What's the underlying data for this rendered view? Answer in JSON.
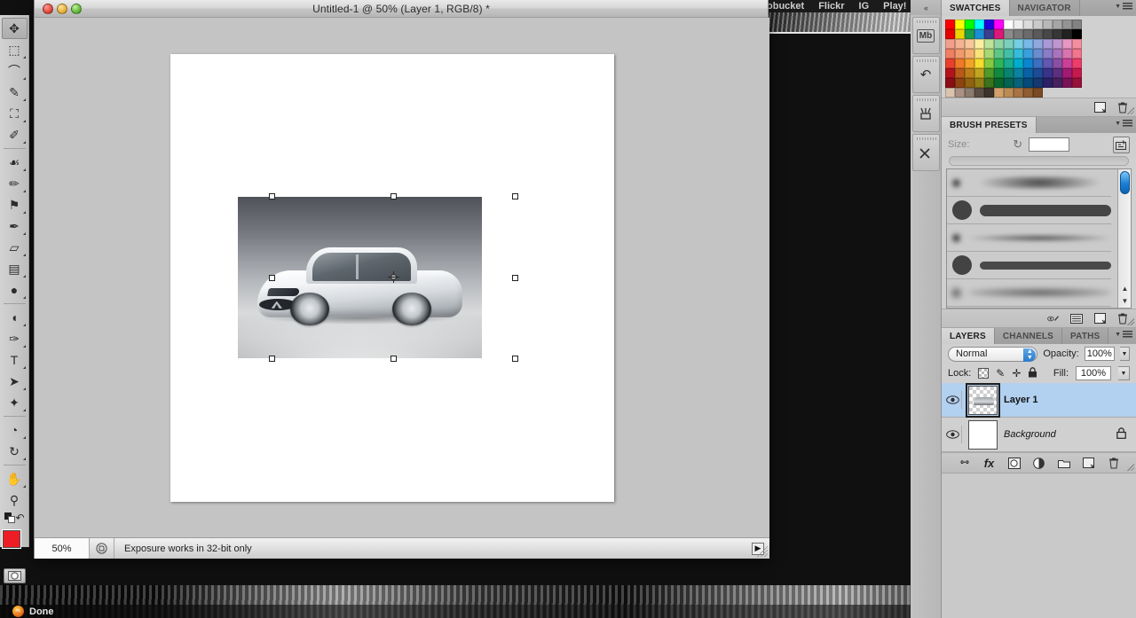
{
  "background": {
    "bookmarks": [
      "obucket",
      "Flickr",
      "IG",
      "Play!"
    ],
    "status_text": "Done",
    "firefox_icon": "firefox-icon"
  },
  "document_window": {
    "title": "Untitled-1 @ 50% (Layer 1, RGB/8) *",
    "traffic_lights": [
      "close",
      "minimize",
      "zoom"
    ],
    "statusbar": {
      "zoom": "50%",
      "doc_icon": "document-icon",
      "message": "Exposure works in 32-bit only",
      "arrow": "▶"
    },
    "canvas_image_alt": "silver sedan on gray gradient background",
    "transform_handles": 8,
    "reference_point": "center"
  },
  "toolbar": {
    "tools": [
      {
        "name": "move-tool",
        "glyph": "✥",
        "active": true,
        "corner": false
      },
      {
        "name": "marquee-tool",
        "glyph": "⬚",
        "active": false,
        "corner": true
      },
      {
        "name": "lasso-tool",
        "glyph": "⌒",
        "active": false,
        "corner": true
      },
      {
        "name": "quick-selection-tool",
        "glyph": "✎",
        "active": false,
        "corner": true
      },
      {
        "name": "crop-tool",
        "glyph": "⛶",
        "active": false,
        "corner": true
      },
      {
        "name": "eyedropper-tool",
        "glyph": "✐",
        "active": false,
        "corner": true
      },
      {
        "name": "spot-healing-brush-tool",
        "glyph": "☙",
        "active": false,
        "corner": true
      },
      {
        "name": "brush-tool",
        "glyph": "✏",
        "active": false,
        "corner": true
      },
      {
        "name": "clone-stamp-tool",
        "glyph": "⚑",
        "active": false,
        "corner": true
      },
      {
        "name": "history-brush-tool",
        "glyph": "✒",
        "active": false,
        "corner": true
      },
      {
        "name": "eraser-tool",
        "glyph": "▱",
        "active": false,
        "corner": true
      },
      {
        "name": "gradient-tool",
        "glyph": "▤",
        "active": false,
        "corner": true
      },
      {
        "name": "blur-tool",
        "glyph": "●",
        "active": false,
        "corner": true
      },
      {
        "name": "dodge-tool",
        "glyph": "◖",
        "active": false,
        "corner": true
      },
      {
        "name": "pen-tool",
        "glyph": "✑",
        "active": false,
        "corner": true
      },
      {
        "name": "type-tool",
        "glyph": "T",
        "active": false,
        "corner": true
      },
      {
        "name": "path-selection-tool",
        "glyph": "➤",
        "active": false,
        "corner": true
      },
      {
        "name": "custom-shape-tool",
        "glyph": "✦",
        "active": false,
        "corner": true
      },
      {
        "name": "3d-object-rotate-tool",
        "glyph": "◔",
        "active": false,
        "corner": true
      },
      {
        "name": "3d-camera-rotate-tool",
        "glyph": "↻",
        "active": false,
        "corner": true
      },
      {
        "name": "hand-tool",
        "glyph": "✋",
        "active": false,
        "corner": true
      },
      {
        "name": "zoom-tool",
        "glyph": "⚲",
        "active": false,
        "corner": false
      }
    ],
    "foreground_color": "#ee1c25",
    "background_color": "#ffffff",
    "quick_mask_icon": "quick-mask-icon",
    "swap_colors_icon": "swap-colors-icon",
    "default_colors_icon": "default-colors-icon"
  },
  "dock_rail": {
    "collapse_icon": "«",
    "buttons": [
      {
        "name": "mini-bridge-panel-button",
        "label": "Mb"
      },
      {
        "name": "history-panel-button",
        "label": "↶"
      },
      {
        "name": "tool-presets-panel-button",
        "label": "⚒"
      },
      {
        "name": "tools-panel-button",
        "label": "⚒"
      }
    ]
  },
  "swatches_panel": {
    "tabs": [
      {
        "label": "SWATCHES",
        "active": true
      },
      {
        "label": "NAVIGATOR",
        "active": false
      }
    ],
    "colors": [
      "#ff0000",
      "#ffff00",
      "#00ff00",
      "#00ffff",
      "#2200dd",
      "#ff00ff",
      "#ffffff",
      "#ededed",
      "#dcdcdc",
      "#cacaca",
      "#b8b8b8",
      "#a6a6a6",
      "#949494",
      "#828282",
      "#e60000",
      "#e8d400",
      "#1a9e4b",
      "#1b8fd6",
      "#3b3f8f",
      "#e0177a",
      "#8c8c8c",
      "#7a7a7a",
      "#6b6b6b",
      "#5a5a5a",
      "#484848",
      "#363636",
      "#222222",
      "#000000",
      "#f2a08c",
      "#f5b394",
      "#f8c79c",
      "#faf0a0",
      "#bde29a",
      "#8fd4a6",
      "#7bd0bb",
      "#74cfe2",
      "#77b9e8",
      "#8fa8de",
      "#a79ad6",
      "#bf97cf",
      "#e897c2",
      "#f58fa0",
      "#ef7f63",
      "#f29a6d",
      "#f5b174",
      "#f7e377",
      "#a8d873",
      "#5ec686",
      "#44bfa5",
      "#35bcd8",
      "#3a9fdc",
      "#6b8dd0",
      "#8b7cc8",
      "#a874bb",
      "#d975ae",
      "#f2758d",
      "#e8402d",
      "#ef7a28",
      "#f3a22a",
      "#f5dd2e",
      "#86c93f",
      "#2fb559",
      "#1aad8e",
      "#00adcd",
      "#0d84cf",
      "#3d6ec0",
      "#6357b2",
      "#8a4fa4",
      "#cc3f97",
      "#ee3d6b",
      "#b5131c",
      "#b75a18",
      "#bb7f1a",
      "#bfa61e",
      "#4f9a28",
      "#12893f",
      "#0a8470",
      "#0b82a0",
      "#0a62a4",
      "#1d4b96",
      "#39338a",
      "#5d2f7f",
      "#a11b73",
      "#c51a4e",
      "#8c0d16",
      "#8e4311",
      "#906212",
      "#937f16",
      "#3a731c",
      "#08672d",
      "#046352",
      "#066278",
      "#06497c",
      "#153870",
      "#2a2166",
      "#46215f",
      "#7a1257",
      "#96123b",
      "#d9c3ae",
      "#a99184",
      "#8a7b6e",
      "#5b4d42",
      "#3b332c",
      "#d2a06a",
      "#bb8b55",
      "#a87444",
      "#8f5d31",
      "#7a4a24"
    ],
    "footer_icons": [
      "new-swatch-icon",
      "delete-swatch-icon"
    ]
  },
  "brush_presets_panel": {
    "tabs": [
      {
        "label": "BRUSH PRESETS",
        "active": true
      }
    ],
    "size_label": "Size:",
    "size_value": "",
    "reset_icon": "reset-icon",
    "toggle_icon": "toggle-brush-panel-icon",
    "brushes": [
      {
        "name": "soft-round-small",
        "dot": 9,
        "blur": 3,
        "stroke": "soft-thick-wave"
      },
      {
        "name": "hard-round-large",
        "dot": 22,
        "blur": 0,
        "stroke": "hard-thick-wave"
      },
      {
        "name": "soft-round-small-2",
        "dot": 9,
        "blur": 3,
        "stroke": "soft-thin-wave"
      },
      {
        "name": "hard-round-large-2",
        "dot": 22,
        "blur": 0,
        "stroke": "hard-thin-wave"
      },
      {
        "name": "soft-round-small-3",
        "dot": 9,
        "blur": 4,
        "stroke": "soft-faint-wave"
      }
    ],
    "footer_icons": [
      "toggle-brush-preview-icon",
      "list-view-icon",
      "new-brush-icon",
      "delete-brush-icon"
    ]
  },
  "layers_panel": {
    "tabs": [
      {
        "label": "LAYERS",
        "active": true
      },
      {
        "label": "CHANNELS",
        "active": false
      },
      {
        "label": "PATHS",
        "active": false
      }
    ],
    "blend_mode": "Normal",
    "opacity_label": "Opacity:",
    "opacity_value": "100%",
    "lock_label": "Lock:",
    "lock_icons": [
      "lock-transparent-pixels-icon",
      "lock-image-pixels-icon",
      "lock-position-icon",
      "lock-all-icon"
    ],
    "fill_label": "Fill:",
    "fill_value": "100%",
    "layers": [
      {
        "name": "Layer 1",
        "selected": true,
        "visible": true,
        "locked": false,
        "italic": false,
        "thumb": "transparent"
      },
      {
        "name": "Background",
        "selected": false,
        "visible": true,
        "locked": true,
        "italic": true,
        "thumb": "white"
      }
    ],
    "footer_icons": [
      "link-layers-icon",
      "layer-style-icon",
      "layer-mask-icon",
      "adjustment-layer-icon",
      "new-group-icon",
      "new-layer-icon",
      "delete-layer-icon"
    ],
    "footer_fx_label": "fx"
  }
}
